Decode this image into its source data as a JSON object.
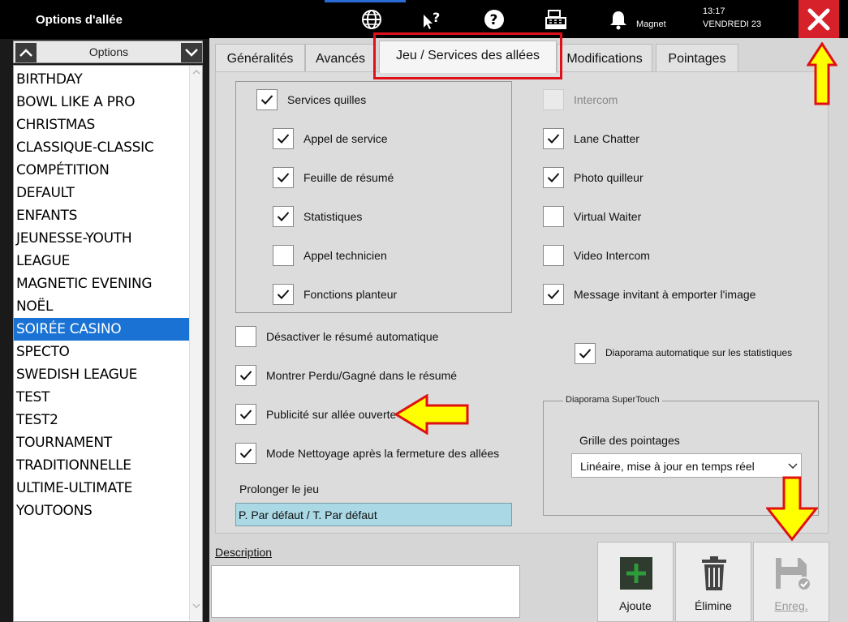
{
  "window": {
    "title": "Options d'allée"
  },
  "header": {
    "user": "Magnet",
    "time": "13:17",
    "date": "VENDREDI 23"
  },
  "sidebar": {
    "title": "Options",
    "items": [
      {
        "label": "BIRTHDAY",
        "selected": false
      },
      {
        "label": "BOWL LIKE A PRO",
        "selected": false
      },
      {
        "label": "CHRISTMAS",
        "selected": false
      },
      {
        "label": "CLASSIQUE-CLASSIC",
        "selected": false
      },
      {
        "label": "COMPÉTITION",
        "selected": false
      },
      {
        "label": "DEFAULT",
        "selected": false
      },
      {
        "label": "ENFANTS",
        "selected": false
      },
      {
        "label": "JEUNESSE-YOUTH",
        "selected": false
      },
      {
        "label": "LEAGUE",
        "selected": false
      },
      {
        "label": "MAGNETIC EVENING",
        "selected": false
      },
      {
        "label": "NOËL",
        "selected": false
      },
      {
        "label": "SOIRÉE CASINO",
        "selected": true
      },
      {
        "label": "SPECTO",
        "selected": false
      },
      {
        "label": "SWEDISH LEAGUE",
        "selected": false
      },
      {
        "label": "TEST",
        "selected": false
      },
      {
        "label": "TEST2",
        "selected": false
      },
      {
        "label": "TOURNAMENT",
        "selected": false
      },
      {
        "label": "TRADITIONNELLE",
        "selected": false
      },
      {
        "label": "ULTIME-ULTIMATE",
        "selected": false
      },
      {
        "label": "YOUTOONS",
        "selected": false
      }
    ]
  },
  "tabs": [
    {
      "label": "Généralités",
      "active": false
    },
    {
      "label": "Avancés",
      "active": false
    },
    {
      "label": "Jeu / Services des allées",
      "active": true
    },
    {
      "label": "Modifications",
      "active": false
    },
    {
      "label": "Pointages",
      "active": false
    }
  ],
  "services": {
    "main": {
      "label": "Services quilles",
      "checked": true
    },
    "items": [
      {
        "label": "Appel de service",
        "checked": true
      },
      {
        "label": "Feuille de résumé",
        "checked": true
      },
      {
        "label": "Statistiques",
        "checked": true
      },
      {
        "label": "Appel technicien",
        "checked": false
      },
      {
        "label": "Fonctions planteur",
        "checked": true
      }
    ]
  },
  "right_options": [
    {
      "label": "Intercom",
      "checked": false,
      "disabled": true
    },
    {
      "label": "Lane Chatter",
      "checked": true,
      "disabled": false
    },
    {
      "label": "Photo quilleur",
      "checked": true,
      "disabled": false
    },
    {
      "label": "Virtual Waiter",
      "checked": false,
      "disabled": false
    },
    {
      "label": "Video Intercom",
      "checked": false,
      "disabled": false
    },
    {
      "label": "Message invitant à emporter l'image",
      "checked": true,
      "disabled": false
    }
  ],
  "lower_options": [
    {
      "label": "Désactiver le résumé automatique",
      "checked": false
    },
    {
      "label": "Montrer Perdu/Gagné dans le résumé",
      "checked": true
    },
    {
      "label": "Publicité sur allée ouverte",
      "checked": true
    },
    {
      "label": "Mode Nettoyage après la fermeture des allées",
      "checked": true
    }
  ],
  "diaporama_auto": {
    "label": "Diaporama automatique sur les statistiques",
    "checked": true
  },
  "supertouch": {
    "group_title": "Diaporama SuperTouch",
    "field_label": "Grille des pointages",
    "selected": "Linéaire, mise à jour en temps réel"
  },
  "prolong": {
    "label": "Prolonger le jeu",
    "value": "P. Par défaut / T. Par défaut"
  },
  "description": {
    "label": "Description",
    "value": ""
  },
  "actions": {
    "add": "Ajoute",
    "delete": "Élimine",
    "save": "Enreg."
  },
  "colors": {
    "accent": "#1a73d4",
    "close": "#d6202a",
    "highlight": "#e0101a",
    "arrow": "#ffff00",
    "add_green": "#2e9b3a"
  }
}
